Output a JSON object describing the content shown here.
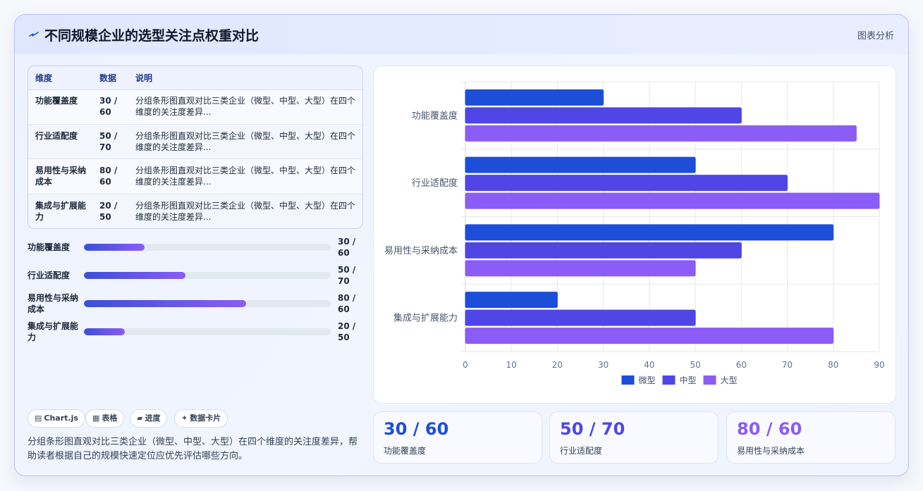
{
  "header": {
    "title": "不同规模企业的选型关注点权重对比",
    "tag": "图表分析"
  },
  "table": {
    "headers": [
      "维度",
      "数据",
      "说明"
    ],
    "rows": [
      {
        "dim": "功能覆盖度",
        "data": "30 / 60",
        "desc": "分组条形图直观对比三类企业（微型、中型、大型）在四个维度的关注度差异..."
      },
      {
        "dim": "行业适配度",
        "data": "50 / 70",
        "desc": "分组条形图直观对比三类企业（微型、中型、大型）在四个维度的关注度差异..."
      },
      {
        "dim": "易用性与采纳成本",
        "data": "80 / 60",
        "desc": "分组条形图直观对比三类企业（微型、中型、大型）在四个维度的关注度差异..."
      },
      {
        "dim": "集成与扩展能力",
        "data": "20 / 50",
        "desc": "分组条形图直观对比三类企业（微型、中型、大型）在四个维度的关注度差异..."
      }
    ]
  },
  "progress": [
    {
      "label": "功能覆盖度",
      "value": "30 / 60",
      "fraction": 0.245
    },
    {
      "label": "行业适配度",
      "value": "50 / 70",
      "fraction": 0.41
    },
    {
      "label": "易用性与采纳成本",
      "value": "80 / 60",
      "fraction": 0.656
    },
    {
      "label": "集成与扩展能力",
      "value": "20 / 50",
      "fraction": 0.165
    }
  ],
  "pills": [
    {
      "icon": "▤",
      "icon_name": "chart-icon",
      "label": "Chart.js"
    },
    {
      "icon": "▦",
      "icon_name": "table-icon",
      "label": "表格"
    },
    {
      "icon": "▰",
      "icon_name": "progress-icon",
      "label": "进度"
    },
    {
      "icon": "✦",
      "icon_name": "card-icon",
      "label": "数据卡片"
    }
  ],
  "description": "分组条形图直观对比三类企业（微型、中型、大型）在四个维度的关注度差异，帮助读者根据自己的规模快速定位应优先评估哪些方向。",
  "stats": [
    {
      "value": "30 / 60",
      "label": "功能覆盖度",
      "color": "#1d4ed8"
    },
    {
      "value": "50 / 70",
      "label": "行业适配度",
      "color": "#4f46e5"
    },
    {
      "value": "80 / 60",
      "label": "易用性与采纳成本",
      "color": "#8b5cf6"
    }
  ],
  "colors": {
    "series_small": "#1d4ed8",
    "series_medium": "#4f46e5",
    "series_large": "#8b5cf6"
  },
  "chart_data": {
    "type": "bar",
    "orientation": "horizontal",
    "categories": [
      "功能覆盖度",
      "行业适配度",
      "易用性与采纳成本",
      "集成与扩展能力"
    ],
    "series": [
      {
        "name": "微型",
        "values": [
          30,
          50,
          80,
          20
        ],
        "color": "#1d4ed8"
      },
      {
        "name": "中型",
        "values": [
          60,
          70,
          60,
          50
        ],
        "color": "#4f46e5"
      },
      {
        "name": "大型",
        "values": [
          85,
          90,
          50,
          80
        ],
        "color": "#8b5cf6"
      }
    ],
    "x_ticks": [
      "0",
      "10",
      "20",
      "30",
      "40",
      "50",
      "60",
      "70",
      "80",
      "90"
    ],
    "xlim": [
      0,
      90
    ],
    "grid": true,
    "legend_position": "bottom"
  }
}
